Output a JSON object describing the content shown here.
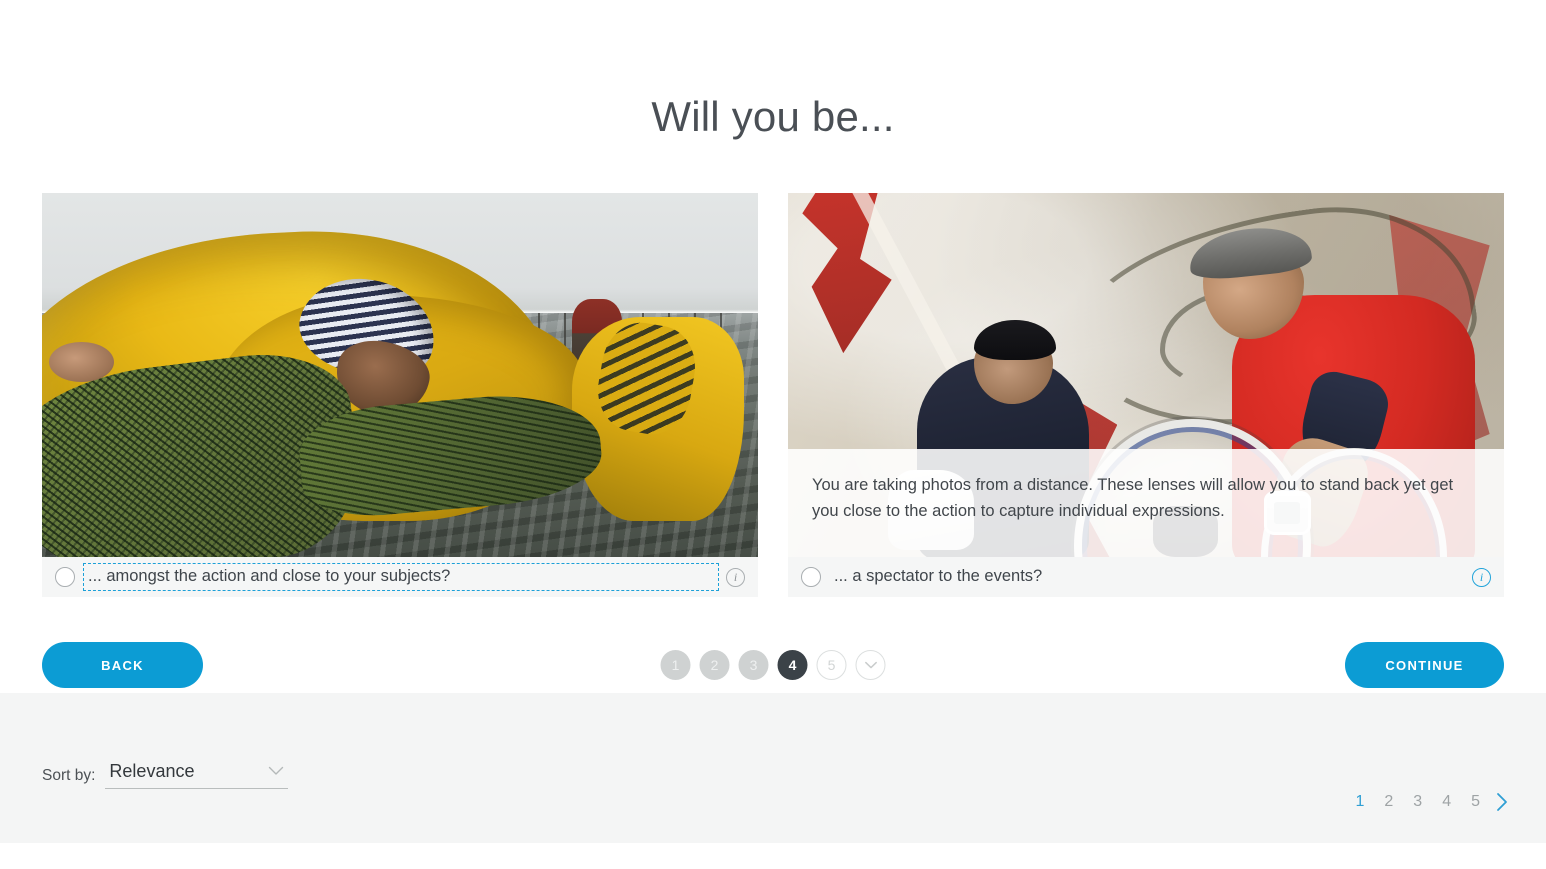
{
  "header": {
    "title": "Will you be..."
  },
  "cards": [
    {
      "id": "close-to-action",
      "photo_name": "fisherman-hauling-nets-photo",
      "option_label": "... amongst the action and close to your subjects?",
      "focused": true,
      "info_icon_glyph": "i",
      "info_icon_active": false
    },
    {
      "id": "spectator",
      "photo_name": "cyclists-at-graffiti-wall-photo",
      "option_label": "... a spectator to the events?",
      "focused": false,
      "info_icon_glyph": "i",
      "info_icon_active": true,
      "tooltip": "You are taking photos from a distance. These lenses will allow you to stand back yet get you close to the action to capture individual expressions."
    }
  ],
  "nav": {
    "back_label": "BACK",
    "continue_label": "CONTINUE",
    "steps": [
      {
        "label": "1",
        "state": "done"
      },
      {
        "label": "2",
        "state": "done"
      },
      {
        "label": "3",
        "state": "done"
      },
      {
        "label": "4",
        "state": "current"
      },
      {
        "label": "5",
        "state": "upcoming"
      }
    ],
    "finish_step_icon": "chevron-down-icon"
  },
  "bottom": {
    "sort_label": "Sort by:",
    "sort_value": "Relevance",
    "sort_chevron_icon": "chevron-down-icon",
    "pages": [
      "1",
      "2",
      "3",
      "4",
      "5"
    ],
    "active_page": "1",
    "next_icon": "chevron-right-icon"
  },
  "colors": {
    "accent": "#0c9cd4",
    "link": "#2f9fd4",
    "current_step": "#3b4248",
    "panel": "#f4f5f5",
    "footer_bar": "#f5f6f6"
  }
}
